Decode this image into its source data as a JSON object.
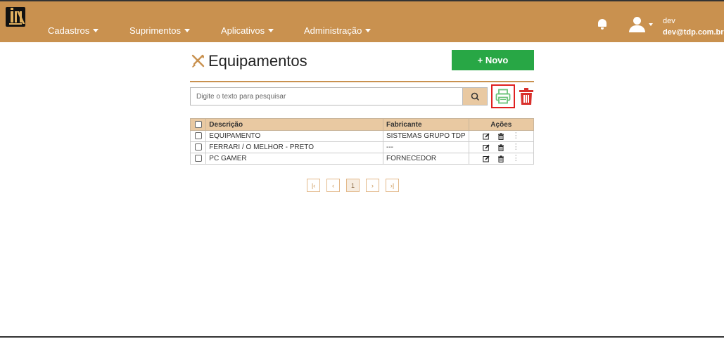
{
  "nav": {
    "items": [
      {
        "label": "Cadastros"
      },
      {
        "label": "Suprimentos"
      },
      {
        "label": "Aplicativos"
      },
      {
        "label": "Administração"
      }
    ],
    "user": {
      "name": "dev",
      "email": "dev@tdp.com.br"
    }
  },
  "page": {
    "title": "Equipamentos",
    "new_button": "+ Novo"
  },
  "search": {
    "placeholder": "Digite o texto para pesquisar"
  },
  "table": {
    "headers": {
      "description": "Descrição",
      "manufacturer": "Fabricante",
      "actions": "Ações"
    },
    "rows": [
      {
        "description": "EQUIPAMENTO",
        "manufacturer": "SISTEMAS GRUPO TDP"
      },
      {
        "description": "FERRARI / O MELHOR - PRETO",
        "manufacturer": "---"
      },
      {
        "description": "PC GAMER",
        "manufacturer": "FORNECEDOR"
      }
    ]
  },
  "pagination": {
    "first": "|‹",
    "prev": "‹",
    "current": "1",
    "next": "›",
    "last": "›|"
  },
  "colors": {
    "brand": "#c9914f",
    "success": "#28a745",
    "danger": "#d9302c",
    "header_fill": "#e9c9a2"
  },
  "icons": [
    "bell-icon",
    "user-icon",
    "tools-icon",
    "search-icon",
    "printer-icon",
    "trash-icon",
    "edit-icon",
    "more-icon"
  ]
}
